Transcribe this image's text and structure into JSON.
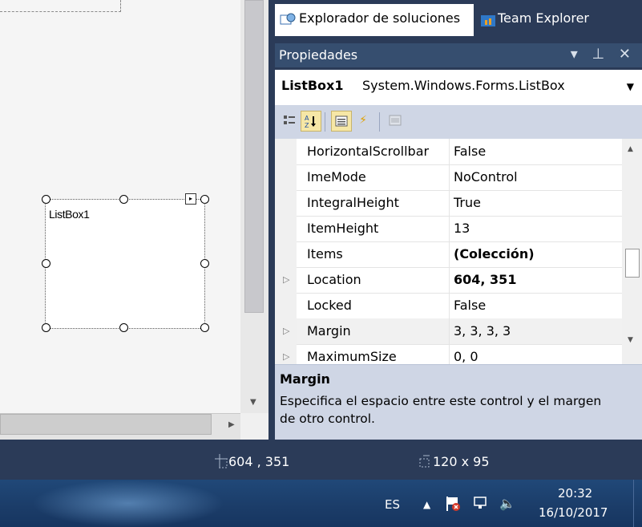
{
  "tabs": {
    "solution_explorer": "Explorador de soluciones",
    "team_explorer": "Team Explorer"
  },
  "properties": {
    "title": "Propiedades",
    "buttons": "▾ ⊥ ✕",
    "object_name": "ListBox1",
    "object_type": "System.Windows.Forms.ListBox",
    "rows": [
      {
        "name": "HorizontalScrollbar",
        "value": "False",
        "bold": false,
        "expand": false
      },
      {
        "name": "ImeMode",
        "value": "NoControl",
        "bold": false,
        "expand": false
      },
      {
        "name": "IntegralHeight",
        "value": "True",
        "bold": false,
        "expand": false
      },
      {
        "name": "ItemHeight",
        "value": "13",
        "bold": false,
        "expand": false
      },
      {
        "name": "Items",
        "value": "(Colección)",
        "bold": true,
        "expand": false
      },
      {
        "name": "Location",
        "value": "604, 351",
        "bold": true,
        "expand": true
      },
      {
        "name": "Locked",
        "value": "False",
        "bold": false,
        "expand": false
      },
      {
        "name": "Margin",
        "value": "3, 3, 3, 3",
        "bold": false,
        "expand": true
      },
      {
        "name": "MaximumSize",
        "value": "0, 0",
        "bold": false,
        "expand": true
      }
    ],
    "description_title": "Margin",
    "description_text": "Especifica el espacio entre este control y el margen de otro control."
  },
  "designer": {
    "listbox_label": "ListBox1"
  },
  "statusbar": {
    "location": "604 , 351",
    "size": "120 x 95"
  },
  "taskbar": {
    "language": "ES",
    "time": "20:32",
    "date": "16/10/2017"
  },
  "colors": {
    "accent": "#2b3b58",
    "panel_header": "#364e6f",
    "toolbar": "#cfd6e5"
  }
}
